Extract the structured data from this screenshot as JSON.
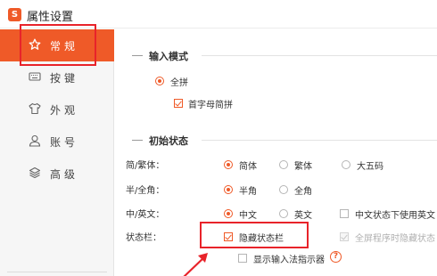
{
  "window": {
    "title": "属性设置",
    "logo_glyph": "S"
  },
  "sidebar": {
    "items": [
      {
        "label": "常规",
        "icon": "star-icon",
        "active": true
      },
      {
        "label": "按键",
        "icon": "keyboard-icon",
        "active": false
      },
      {
        "label": "外观",
        "icon": "shirt-icon",
        "active": false
      },
      {
        "label": "账号",
        "icon": "user-icon",
        "active": false
      },
      {
        "label": "高级",
        "icon": "layers-icon",
        "active": false
      }
    ]
  },
  "input_mode": {
    "title": "输入模式",
    "quanpin": {
      "label": "全拼",
      "checked": true
    },
    "initials": {
      "label": "首字母简拼",
      "checked": true
    }
  },
  "initial_state": {
    "title": "初始状态",
    "simp_trad": {
      "label": "简/繁体：",
      "options": [
        {
          "label": "简体",
          "checked": true
        },
        {
          "label": "繁体",
          "checked": false
        },
        {
          "label": "大五码",
          "checked": false
        }
      ]
    },
    "half_full": {
      "label": "半/全角：",
      "options": [
        {
          "label": "半角",
          "checked": true
        },
        {
          "label": "全角",
          "checked": false
        }
      ]
    },
    "cn_en": {
      "label": "中/英文：",
      "options": [
        {
          "label": "中文",
          "checked": true
        },
        {
          "label": "英文",
          "checked": false
        }
      ],
      "extra": {
        "label": "中文状态下使用英文",
        "checked": false
      }
    },
    "status_bar": {
      "label": "状态栏：",
      "hide": {
        "label": "隐藏状态栏",
        "checked": true
      },
      "fullscreen_hide": {
        "label": "全屏程序时隐藏状态",
        "checked": true,
        "disabled": true
      },
      "show_indicator": {
        "label": "显示输入法指示器",
        "checked": false
      },
      "help_glyph": "?"
    }
  },
  "colors": {
    "accent": "#ef5a28",
    "highlight": "#e8232a"
  }
}
